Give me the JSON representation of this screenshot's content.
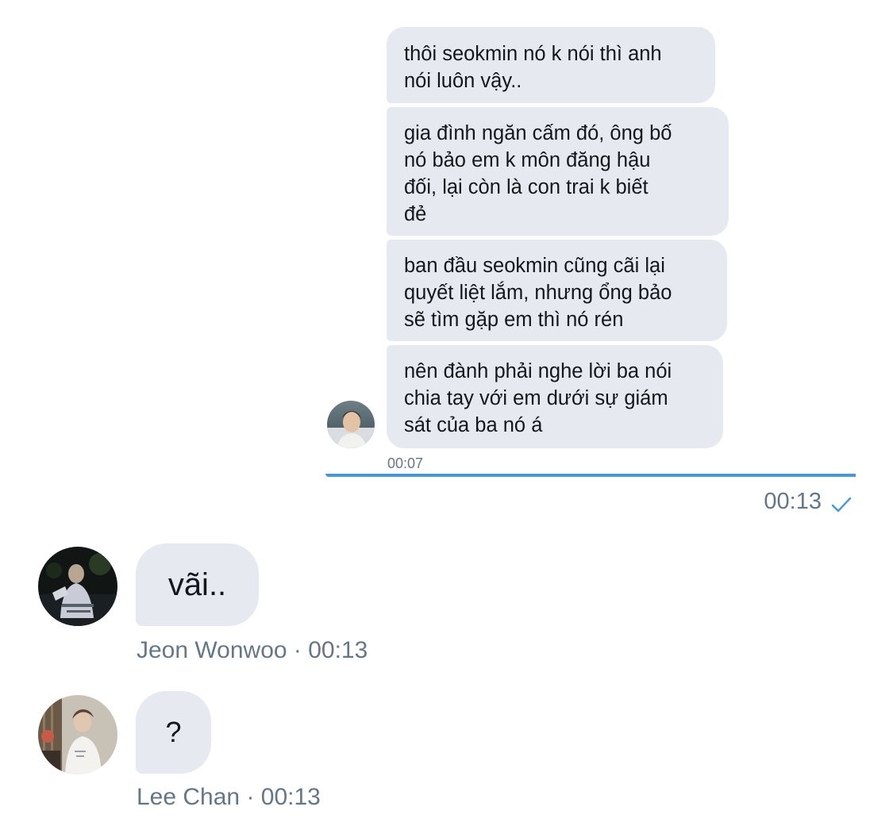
{
  "quoted": {
    "messages": [
      {
        "lines": [
          "thôi seokmin nó k nói thì anh",
          "nói luôn vậy.."
        ]
      },
      {
        "lines": [
          "gia đình ngăn cấm đó, ông bố",
          "nó bảo em k môn đăng hậu",
          "đối, lại còn là con trai k biết",
          "đẻ"
        ]
      },
      {
        "lines": [
          "ban đầu seokmin cũng cãi lại",
          "quyết liệt lắm, nhưng ổng bảo",
          "sẽ tìm gặp em thì nó rén"
        ]
      },
      {
        "lines": [
          "nên đành phải nghe lời ba nói",
          "chia tay với em dưới sự giám",
          "sát của ba nó á"
        ]
      }
    ],
    "time": "00:07",
    "accent_color": "#4a97d3"
  },
  "sent": {
    "time": "00:13",
    "status_icon": "check-icon"
  },
  "received": [
    {
      "text": "vãi..",
      "meta": "Jeon Wonwoo · 00:13"
    },
    {
      "text": "?",
      "meta": "Lee Chan · 00:13"
    }
  ],
  "colors": {
    "bubble": "#e6e9ef",
    "meta_text": "#657786",
    "message_text": "#14171a"
  }
}
